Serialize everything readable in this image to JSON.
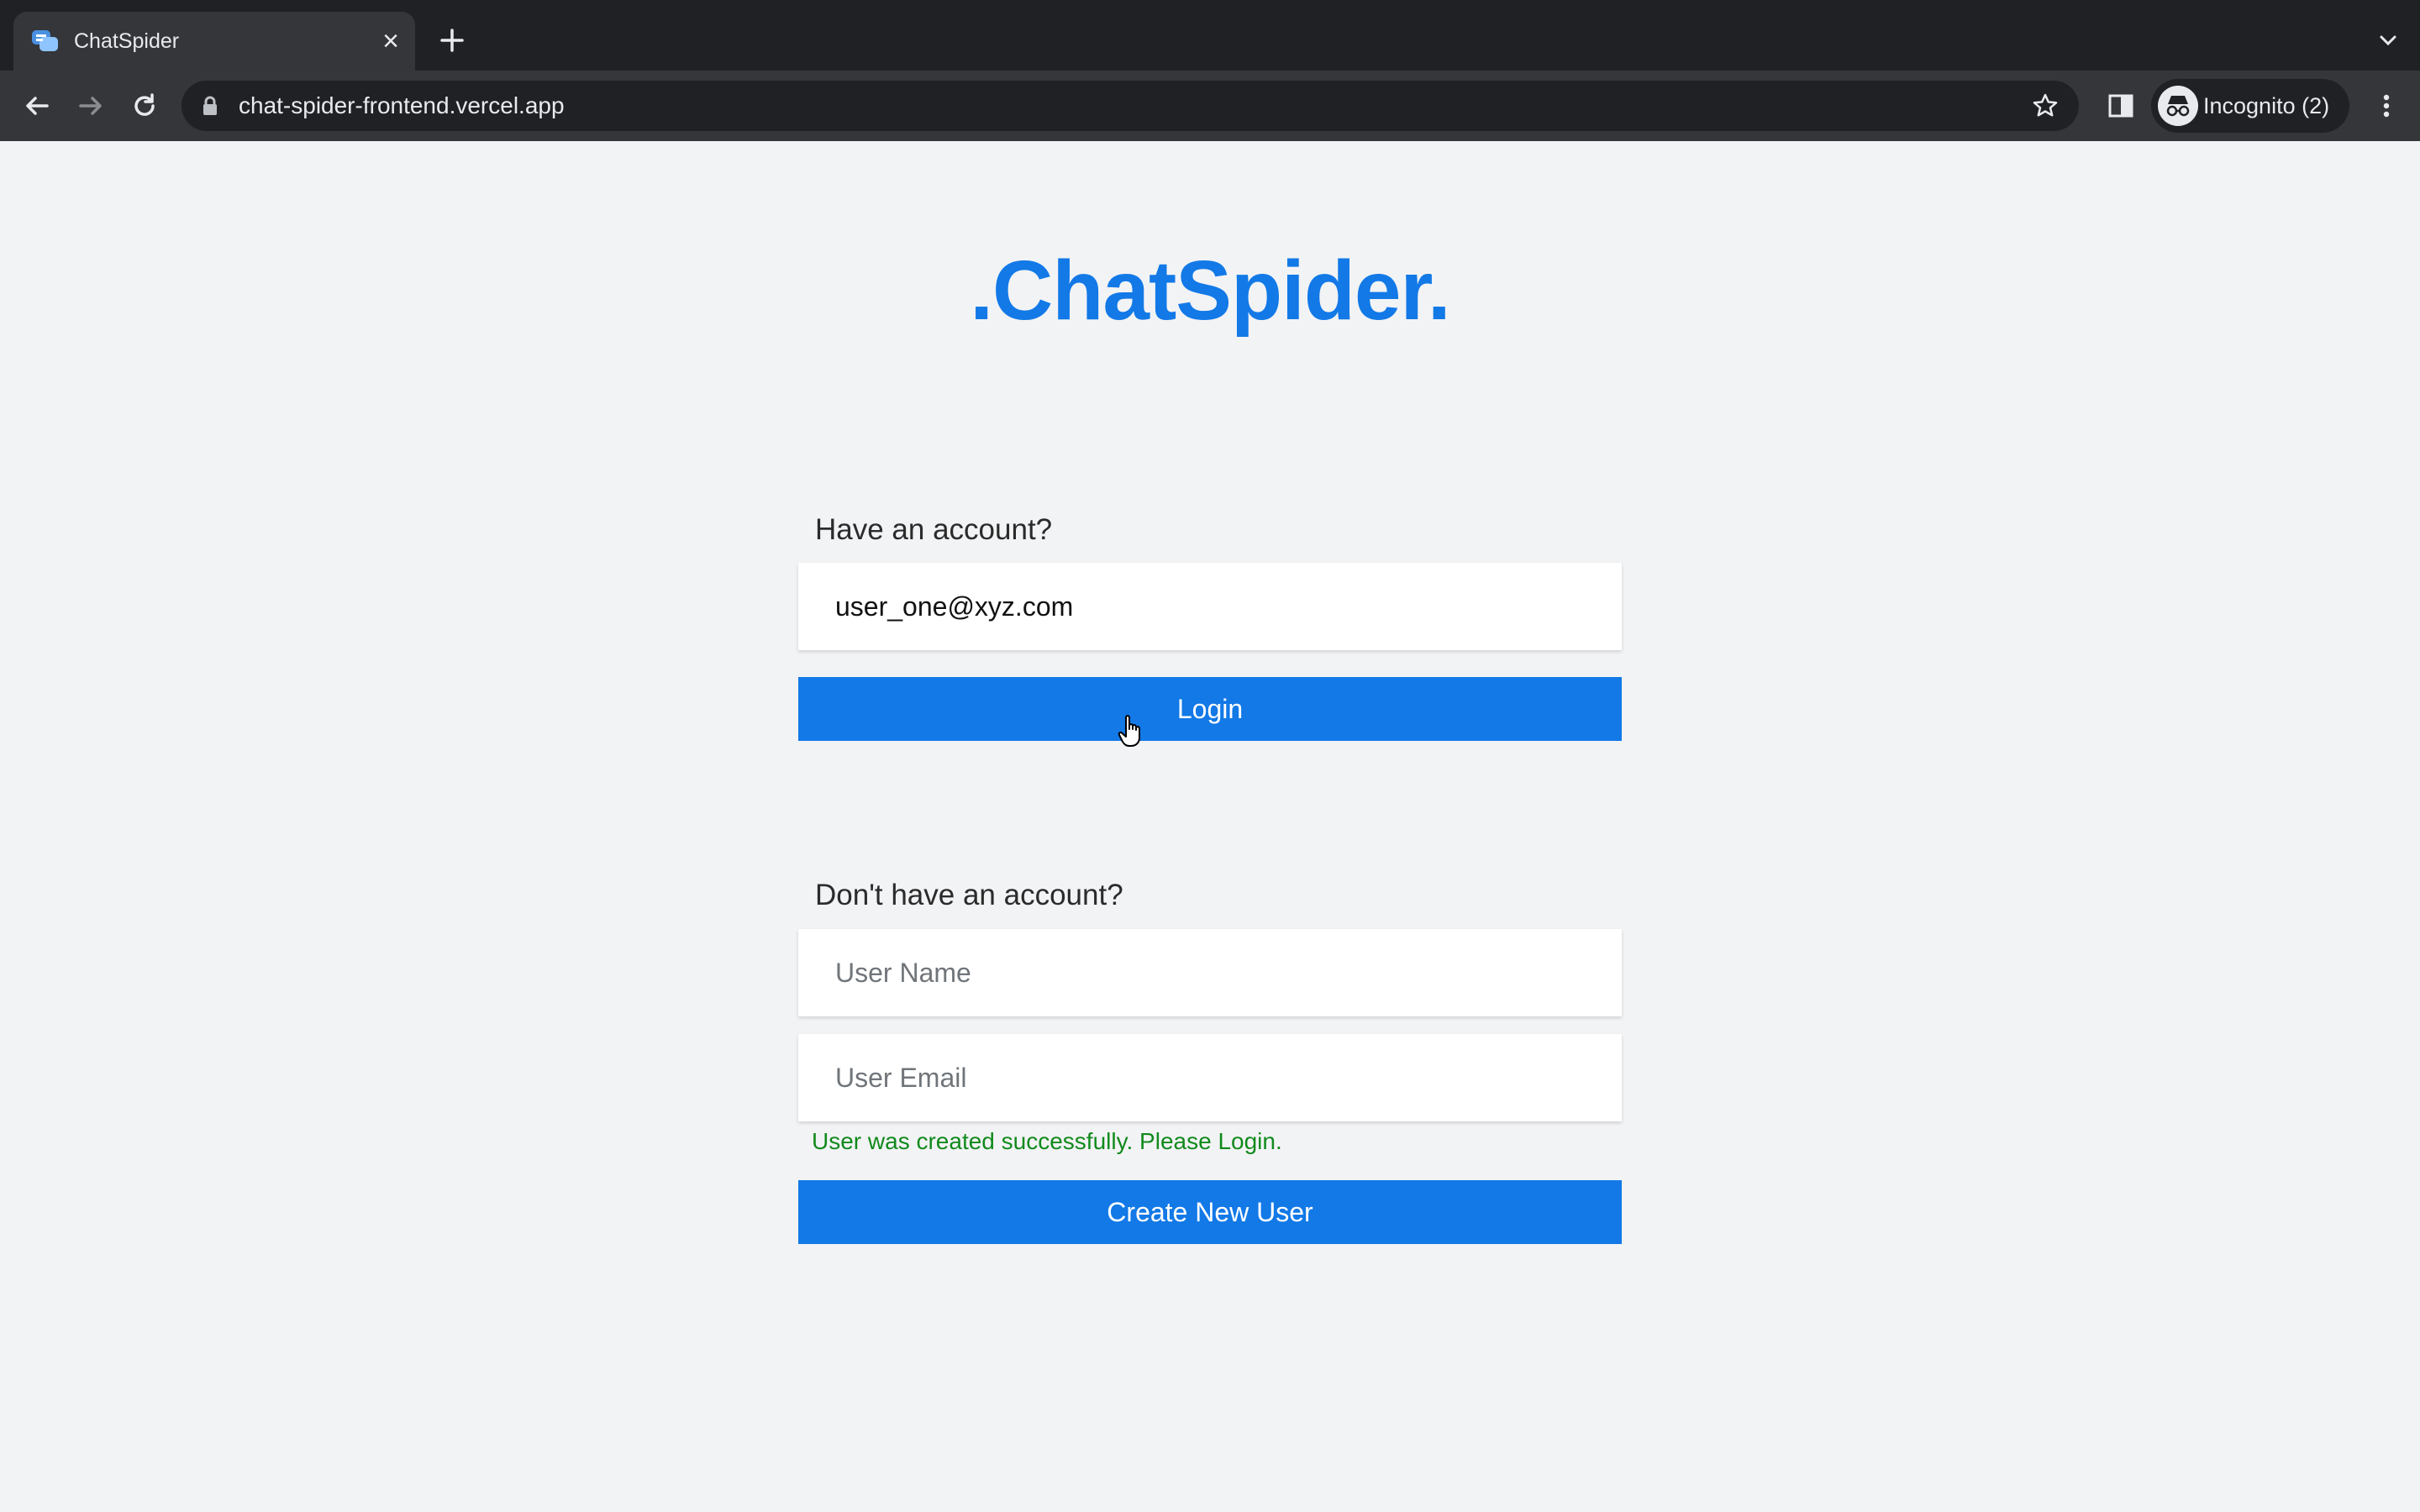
{
  "browser": {
    "tab_title": "ChatSpider",
    "url": "chat-spider-frontend.vercel.app",
    "profile_label": "Incognito (2)"
  },
  "brand": {
    "title": ".ChatSpider."
  },
  "login": {
    "heading": "Have an account?",
    "email_value": "user_one@xyz.com",
    "button_label": "Login"
  },
  "signup": {
    "heading": "Don't have an account?",
    "name_placeholder": "User Name",
    "email_placeholder": "User Email",
    "success_message": "User was created successfully. Please Login.",
    "button_label": "Create New User"
  },
  "colors": {
    "accent": "#1279e7",
    "success": "#118a1c"
  }
}
